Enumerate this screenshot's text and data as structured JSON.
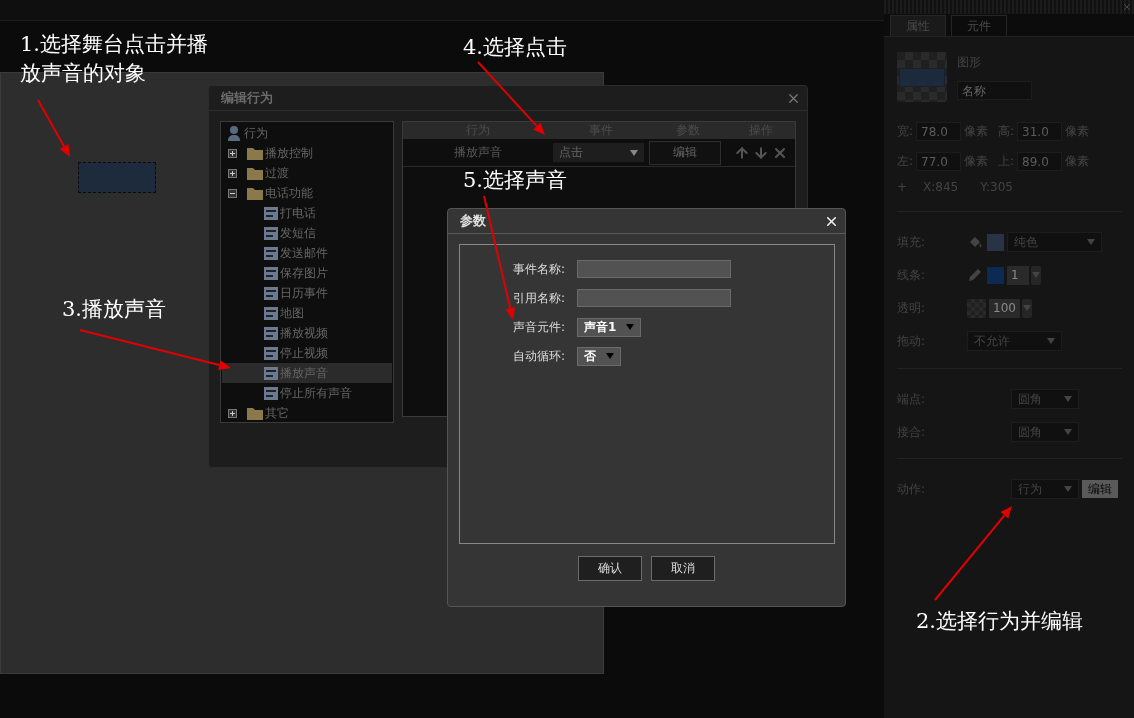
{
  "behavior_dialog": {
    "title": "编辑行为",
    "tree": [
      {
        "label": "行为",
        "kind": "root",
        "children": [
          {
            "label": "播放控制",
            "kind": "folder",
            "expanded": false
          },
          {
            "label": "过渡",
            "kind": "folder",
            "expanded": false
          },
          {
            "label": "电话功能",
            "kind": "folder",
            "expanded": true,
            "children": [
              {
                "label": "打电话",
                "kind": "leaf",
                "selected": false
              },
              {
                "label": "发短信",
                "kind": "leaf",
                "selected": false
              },
              {
                "label": "发送邮件",
                "kind": "leaf",
                "selected": false
              },
              {
                "label": "保存图片",
                "kind": "leaf",
                "selected": false
              },
              {
                "label": "日历事件",
                "kind": "leaf",
                "selected": false
              },
              {
                "label": "地图",
                "kind": "leaf",
                "selected": false
              },
              {
                "label": "播放视频",
                "kind": "leaf",
                "selected": false
              },
              {
                "label": "停止视频",
                "kind": "leaf",
                "selected": false
              },
              {
                "label": "播放声音",
                "kind": "leaf",
                "selected": true
              },
              {
                "label": "停止所有声音",
                "kind": "leaf",
                "selected": false
              }
            ]
          },
          {
            "label": "其它",
            "kind": "folder",
            "expanded": false
          }
        ]
      }
    ],
    "table": {
      "columns": [
        "行为",
        "事件",
        "参数",
        "操作"
      ],
      "rows": [
        {
          "behavior": "播放声音",
          "event": "点击",
          "param_button": "编辑"
        }
      ]
    }
  },
  "params_dialog": {
    "title": "参数",
    "fields": [
      {
        "kind": "text",
        "label": "事件名称:"
      },
      {
        "kind": "text",
        "label": "引用名称:"
      },
      {
        "kind": "select",
        "label": "声音元件:",
        "value": "声音1"
      },
      {
        "kind": "select",
        "label": "自动循环:",
        "value": "否"
      }
    ],
    "buttons": [
      "确认",
      "取消"
    ]
  },
  "properties_panel": {
    "tabs": [
      {
        "label": "属性",
        "selected": true
      },
      {
        "label": "元件",
        "selected": false
      }
    ],
    "object_type": "图形",
    "name_field": {
      "placeholder": "名称"
    },
    "geometry_rows": [
      [
        {
          "label": "宽:",
          "value": "78.0",
          "unit": "像素"
        },
        {
          "label": "高:",
          "value": "31.0",
          "unit": "像素"
        }
      ],
      [
        {
          "label": "左:",
          "value": "77.0",
          "unit": "像素"
        },
        {
          "label": "上:",
          "value": "89.0",
          "unit": "像素"
        }
      ]
    ],
    "cursor": {
      "marker": "+",
      "x": "X:845",
      "y": "Y:305"
    },
    "style_rows": [
      {
        "kind": "fill",
        "label": "填充:",
        "color": "#283446",
        "value": "纯色"
      },
      {
        "kind": "stroke",
        "label": "线条:",
        "color": "#0c2a52",
        "value": "1"
      },
      {
        "kind": "opacity",
        "label": "透明:",
        "value": "100"
      },
      {
        "kind": "select",
        "label": "拖动:",
        "value": "不允许"
      }
    ],
    "line_rows": [
      {
        "label": "端点:",
        "value": "圆角"
      },
      {
        "label": "接合:",
        "value": "圆角"
      }
    ],
    "action_row": {
      "label": "动作:",
      "value": "行为",
      "button": "编辑"
    }
  },
  "annotations": [
    {
      "text": "1.选择舞台点击并播放声音的对象"
    },
    {
      "text": "4.选择点击"
    },
    {
      "text": "5.选择声音"
    },
    {
      "text": "3.播放声音"
    },
    {
      "text": "2.选择行为并编辑"
    }
  ]
}
